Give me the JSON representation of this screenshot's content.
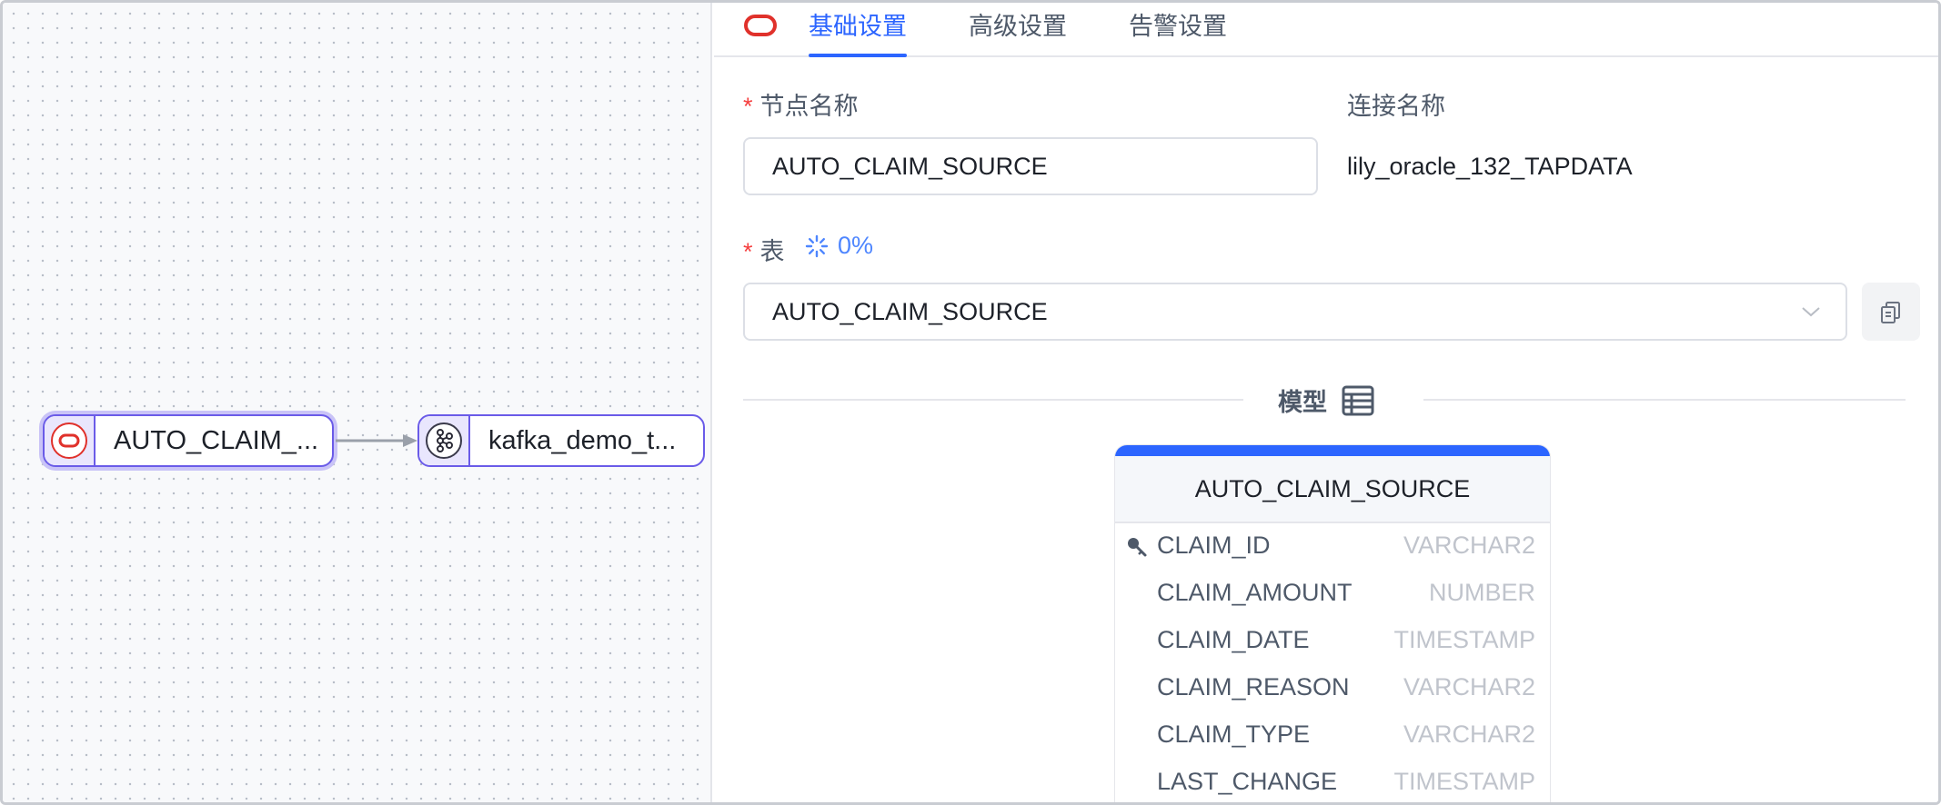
{
  "canvas": {
    "source_node": {
      "label": "AUTO_CLAIM_..."
    },
    "target_node": {
      "label": "kafka_demo_t..."
    }
  },
  "tabs": [
    {
      "label": "基础设置",
      "active": true
    },
    {
      "label": "高级设置",
      "active": false
    },
    {
      "label": "告警设置",
      "active": false
    }
  ],
  "form": {
    "node_name": {
      "label": "节点名称",
      "value": "AUTO_CLAIM_SOURCE"
    },
    "connection_name": {
      "label": "连接名称",
      "value": "lily_oracle_132_TAPDATA"
    },
    "table": {
      "label": "表",
      "progress": "0%",
      "value": "AUTO_CLAIM_SOURCE"
    }
  },
  "model": {
    "title": "模型",
    "table_name": "AUTO_CLAIM_SOURCE",
    "fields": [
      {
        "name": "CLAIM_ID",
        "type": "VARCHAR2",
        "primary_key": true
      },
      {
        "name": "CLAIM_AMOUNT",
        "type": "NUMBER",
        "primary_key": false
      },
      {
        "name": "CLAIM_DATE",
        "type": "TIMESTAMP",
        "primary_key": false
      },
      {
        "name": "CLAIM_REASON",
        "type": "VARCHAR2",
        "primary_key": false
      },
      {
        "name": "CLAIM_TYPE",
        "type": "VARCHAR2",
        "primary_key": false
      },
      {
        "name": "LAST_CHANGE",
        "type": "TIMESTAMP",
        "primary_key": false
      }
    ]
  },
  "colors": {
    "accent": "#2c65ff",
    "node_border": "#6a5be8",
    "oracle_red": "#e0312b",
    "required": "#f53f3f"
  },
  "icons": {
    "tab_source": "oracle-icon",
    "source_node": "oracle-icon",
    "target_node": "kafka-icon",
    "table_progress": "loading-spinner-icon",
    "table_select": "chevron-down-icon",
    "copy_button": "copy-icon",
    "model_title": "table-icon",
    "primary_key": "key-icon"
  }
}
